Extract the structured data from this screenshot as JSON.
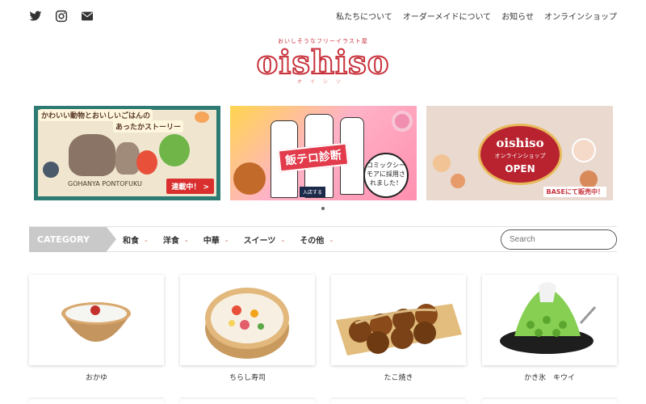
{
  "top_nav": {
    "social_icons": [
      "twitter-icon",
      "instagram-icon",
      "mail-icon"
    ],
    "links": [
      "私たちについて",
      "オーダーメイドについて",
      "お知らせ",
      "オンラインショップ"
    ]
  },
  "logo": {
    "tagline": "おいしそうなフリーイラスト屋",
    "name": "oishiso",
    "reading": "オイシソ",
    "color": "#c8323c"
  },
  "banners": [
    {
      "title": "かわいい動物とおいしいごはんの",
      "subtitle": "あったかストーリー",
      "series": "GOHANYA PONTOFUKU",
      "badge": "連載中！ >"
    },
    {
      "title": "飯テロ診断",
      "bubble": "コミックシーモアに採用されました！",
      "button": "入店する"
    },
    {
      "brand": "oishiso",
      "line1": "オンラインショップ",
      "line2": "OPEN",
      "footer": "BASEにて販売中！"
    }
  ],
  "category_bar": {
    "label": "CATEGORY",
    "items": [
      "和食",
      "洋食",
      "中華",
      "スイーツ",
      "その他"
    ],
    "search_placeholder": "Search"
  },
  "cards": [
    {
      "title": "おかゆ"
    },
    {
      "title": "ちらし寿司"
    },
    {
      "title": "たこ焼き"
    },
    {
      "title": "かき氷　キウイ"
    }
  ]
}
